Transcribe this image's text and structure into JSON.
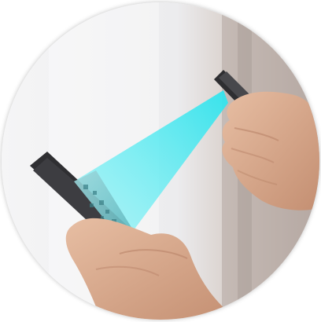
{
  "image": {
    "subject": "phone-scanning-phone",
    "colors": {
      "background_light": "#f3f3f4",
      "background_warm": "#d9cdc6",
      "curtain": "#a89a94",
      "beam": "#32e6ee",
      "phone_body": "#3b3b3e",
      "skin": "#d9ab8e",
      "skin_shadow": "#b98469"
    }
  }
}
